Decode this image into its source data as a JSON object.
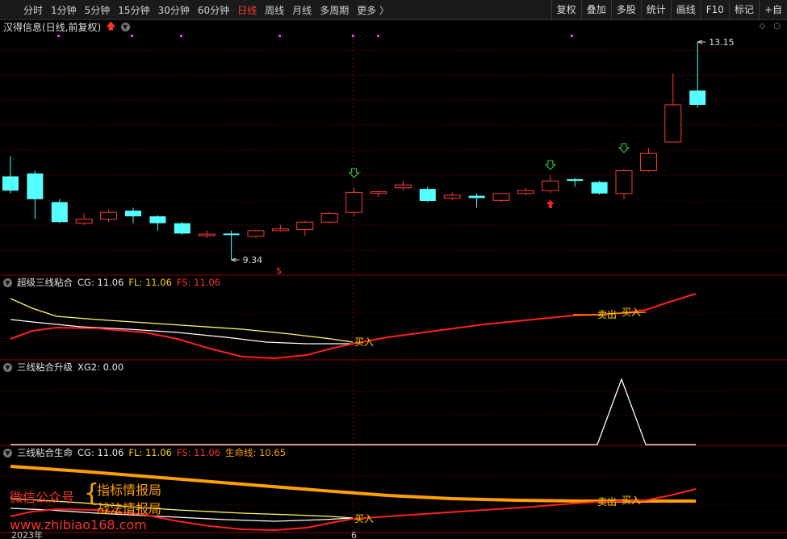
{
  "toolbar": {
    "periods": [
      "分时",
      "1分钟",
      "5分钟",
      "15分钟",
      "30分钟",
      "60分钟",
      "日线",
      "周线",
      "月线",
      "多周期",
      "更多 〉"
    ],
    "active": "日线",
    "tools": [
      "复权",
      "叠加",
      "多股",
      "统计",
      "画线",
      "F10",
      "标记",
      "+自"
    ]
  },
  "main": {
    "title": "汉得信息(日线,前复权)",
    "high_label": "13.15",
    "low_label": "9.34",
    "candles": [
      {
        "o": 10.8,
        "c": 10.55,
        "h": 11.15,
        "l": 10.5
      },
      {
        "o": 10.85,
        "c": 10.4,
        "h": 10.9,
        "l": 10.05
      },
      {
        "o": 10.35,
        "c": 10.0,
        "h": 10.4,
        "l": 9.98
      },
      {
        "o": 9.98,
        "c": 10.05,
        "h": 10.15,
        "l": 9.95
      },
      {
        "o": 10.05,
        "c": 10.17,
        "h": 10.22,
        "l": 10.0
      },
      {
        "o": 10.2,
        "c": 10.1,
        "h": 10.25,
        "l": 9.98
      },
      {
        "o": 10.1,
        "c": 9.98,
        "h": 10.12,
        "l": 9.85
      },
      {
        "o": 9.98,
        "c": 9.8,
        "h": 10.0,
        "l": 9.78
      },
      {
        "o": 9.78,
        "c": 9.79,
        "h": 9.85,
        "l": 9.72
      },
      {
        "o": 9.8,
        "c": 9.78,
        "h": 9.85,
        "l": 9.34
      },
      {
        "o": 9.75,
        "c": 9.85,
        "h": 9.87,
        "l": 9.72
      },
      {
        "o": 9.85,
        "c": 9.88,
        "h": 9.95,
        "l": 9.84
      },
      {
        "o": 9.87,
        "c": 10.0,
        "h": 10.02,
        "l": 9.76
      },
      {
        "o": 10.0,
        "c": 10.15,
        "h": 10.18,
        "l": 9.98
      },
      {
        "o": 10.17,
        "c": 10.52,
        "h": 10.6,
        "l": 10.1
      },
      {
        "o": 10.52,
        "c": 10.53,
        "h": 10.55,
        "l": 10.44
      },
      {
        "o": 10.6,
        "c": 10.65,
        "h": 10.72,
        "l": 10.55
      },
      {
        "o": 10.58,
        "c": 10.37,
        "h": 10.62,
        "l": 10.35
      },
      {
        "o": 10.42,
        "c": 10.47,
        "h": 10.52,
        "l": 10.38
      },
      {
        "o": 10.46,
        "c": 10.42,
        "h": 10.5,
        "l": 10.25
      },
      {
        "o": 10.38,
        "c": 10.5,
        "h": 10.5,
        "l": 10.35
      },
      {
        "o": 10.5,
        "c": 10.55,
        "h": 10.6,
        "l": 10.47
      },
      {
        "o": 10.55,
        "c": 10.72,
        "h": 10.82,
        "l": 10.5
      },
      {
        "o": 10.75,
        "c": 10.72,
        "h": 10.77,
        "l": 10.62
      },
      {
        "o": 10.7,
        "c": 10.5,
        "h": 10.72,
        "l": 10.48
      },
      {
        "o": 10.5,
        "c": 10.9,
        "h": 10.92,
        "l": 10.4
      },
      {
        "o": 10.9,
        "c": 11.2,
        "h": 11.3,
        "l": 10.88
      },
      {
        "o": 11.4,
        "c": 12.05,
        "h": 12.6,
        "l": 11.4
      },
      {
        "o": 12.3,
        "c": 12.05,
        "h": 13.15,
        "l": 12.0
      }
    ]
  },
  "panel1": {
    "name": "超级三线粘合",
    "cg_label": "CG: 11.06",
    "fl_label": "FL: 11.06",
    "fs_label": "FS: 11.06",
    "buy_text": "买入",
    "sell_text": "卖出"
  },
  "panel2": {
    "name": "三线粘合升级",
    "xg_label": "XG2: 0.00"
  },
  "panel3": {
    "name": "三线粘合生命",
    "cg_label": "CG: 11.06",
    "fl_label": "FL: 11.06",
    "fs_label": "FS: 11.06",
    "life_label": "生命线: 10.65",
    "buy_text": "买入",
    "sell_text": "卖出"
  },
  "xaxis": {
    "year_label": "2023年",
    "month_label": "6"
  },
  "watermark": {
    "left": "微信公众号",
    "brace": "{",
    "line1": "指标情报局",
    "line2": "战法情报局",
    "url": "www.zhibiao168.com"
  },
  "colors": {
    "up": "#ff3b3b",
    "down": "#54ffff",
    "yellow": "#ffff66",
    "white": "#ffffff",
    "red": "#ff2020",
    "orange": "#ffa000",
    "grid": "#5a0000"
  }
}
